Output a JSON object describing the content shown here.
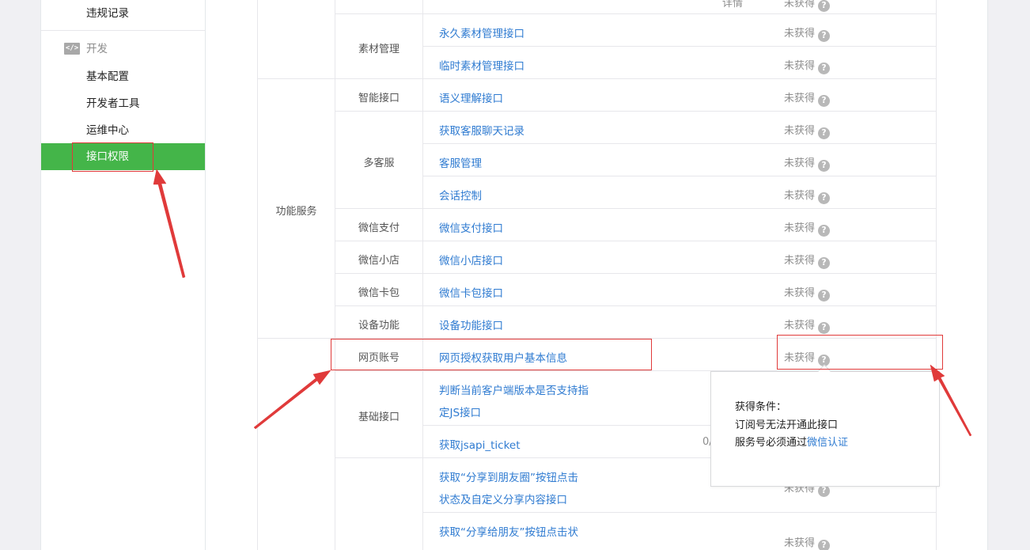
{
  "sidebar": {
    "top_item": "违规记录",
    "section_icon_text": "</>",
    "section_label": "开发",
    "items": [
      {
        "label": "基本配置"
      },
      {
        "label": "开发者工具"
      },
      {
        "label": "运维中心"
      },
      {
        "label": "接口权限"
      }
    ]
  },
  "table": {
    "partial_top_status": "详情",
    "categories": {
      "func_services": "功能服务"
    },
    "groups": {
      "material": "素材管理",
      "smart": "智能接口",
      "kefu": "多客服",
      "pay": "微信支付",
      "shop": "微信小店",
      "card": "微信卡包",
      "device": "设备功能",
      "web_account": "网页账号",
      "basic": "基础接口"
    },
    "apis": {
      "perm_material": "永久素材管理接口",
      "temp_material": "临时素材管理接口",
      "semantic": "语义理解接口",
      "kefu_log": "获取客服聊天记录",
      "kefu_manage": "客服管理",
      "session_ctrl": "会话控制",
      "pay_api": "微信支付接口",
      "shop_api": "微信小店接口",
      "card_api": "微信卡包接口",
      "device_api": "设备功能接口",
      "oauth_api": "网页授权获取用户基本信息",
      "check_js_1": "判断当前客户端版本是否支持指",
      "check_js_2": "定JS接口",
      "jsapi_ticket": "获取jsapi_ticket",
      "share_timeline_1": "获取“分享到朋友圈”按钮点击",
      "share_timeline_2": "状态及自定义分享内容接口",
      "share_friend_1": "获取“分享给朋友”按钮点击状"
    },
    "status_text": "未获得",
    "help_glyph": "?",
    "partial_count": "0/"
  },
  "popover": {
    "title": "获得条件：",
    "line1": "订阅号无法开通此接口",
    "line2_prefix": "服务号必须通过",
    "line2_link": "微信认证"
  },
  "colors": {
    "accent_green": "#44b549",
    "link_blue": "#2f7bd1",
    "annotation_red": "#e03a3a"
  }
}
